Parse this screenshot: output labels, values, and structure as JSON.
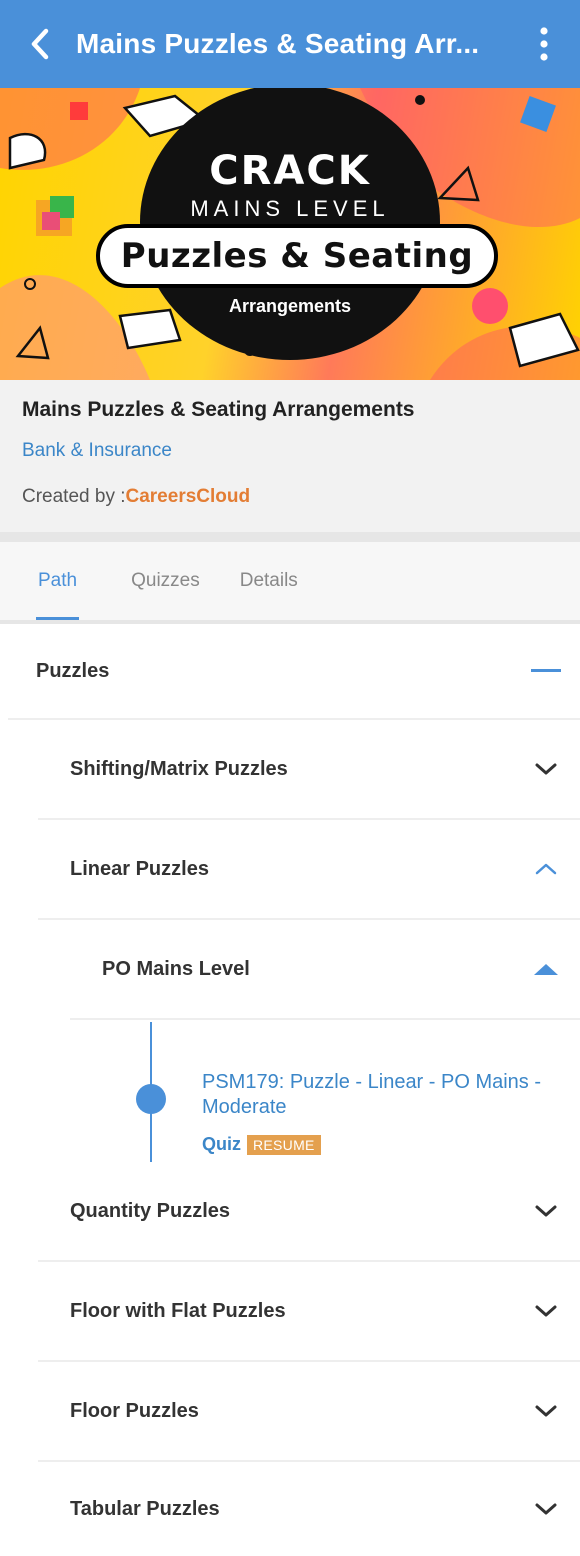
{
  "appbar": {
    "title": "Mains Puzzles & Seating Arr...",
    "back_icon": "chevron-left-icon",
    "more_icon": "more-vert-icon"
  },
  "banner": {
    "line1": "CRACK",
    "line2": "MAINS LEVEL",
    "line3": "Puzzles & Seating",
    "line4": "Arrangements"
  },
  "course": {
    "name": "Mains Puzzles & Seating Arrangements",
    "category": "Bank & Insurance",
    "created_by_label": "Created by :",
    "creator": "CareersCloud"
  },
  "tabs": [
    {
      "label": "Path",
      "active": true
    },
    {
      "label": "Quizzes",
      "active": false
    },
    {
      "label": "Details",
      "active": false
    }
  ],
  "path": {
    "section": {
      "label": "Puzzles",
      "state": "expanded"
    },
    "topics": [
      {
        "label": "Shifting/Matrix Puzzles",
        "state": "collapsed"
      },
      {
        "label": "Linear Puzzles",
        "state": "expanded"
      },
      {
        "label": "Quantity Puzzles",
        "state": "collapsed"
      },
      {
        "label": "Floor with Flat Puzzles",
        "state": "collapsed"
      },
      {
        "label": "Floor Puzzles",
        "state": "collapsed"
      },
      {
        "label": "Tabular Puzzles",
        "state": "collapsed"
      }
    ],
    "subtopic": {
      "label": "PO Mains Level",
      "state": "expanded"
    },
    "item": {
      "title": "PSM179: Puzzle - Linear - PO Mains - Moderate",
      "type": "Quiz",
      "badge": "RESUME"
    }
  },
  "colors": {
    "primary": "#4a90d9",
    "accent": "#e37d34",
    "badge": "#e4a04e"
  }
}
